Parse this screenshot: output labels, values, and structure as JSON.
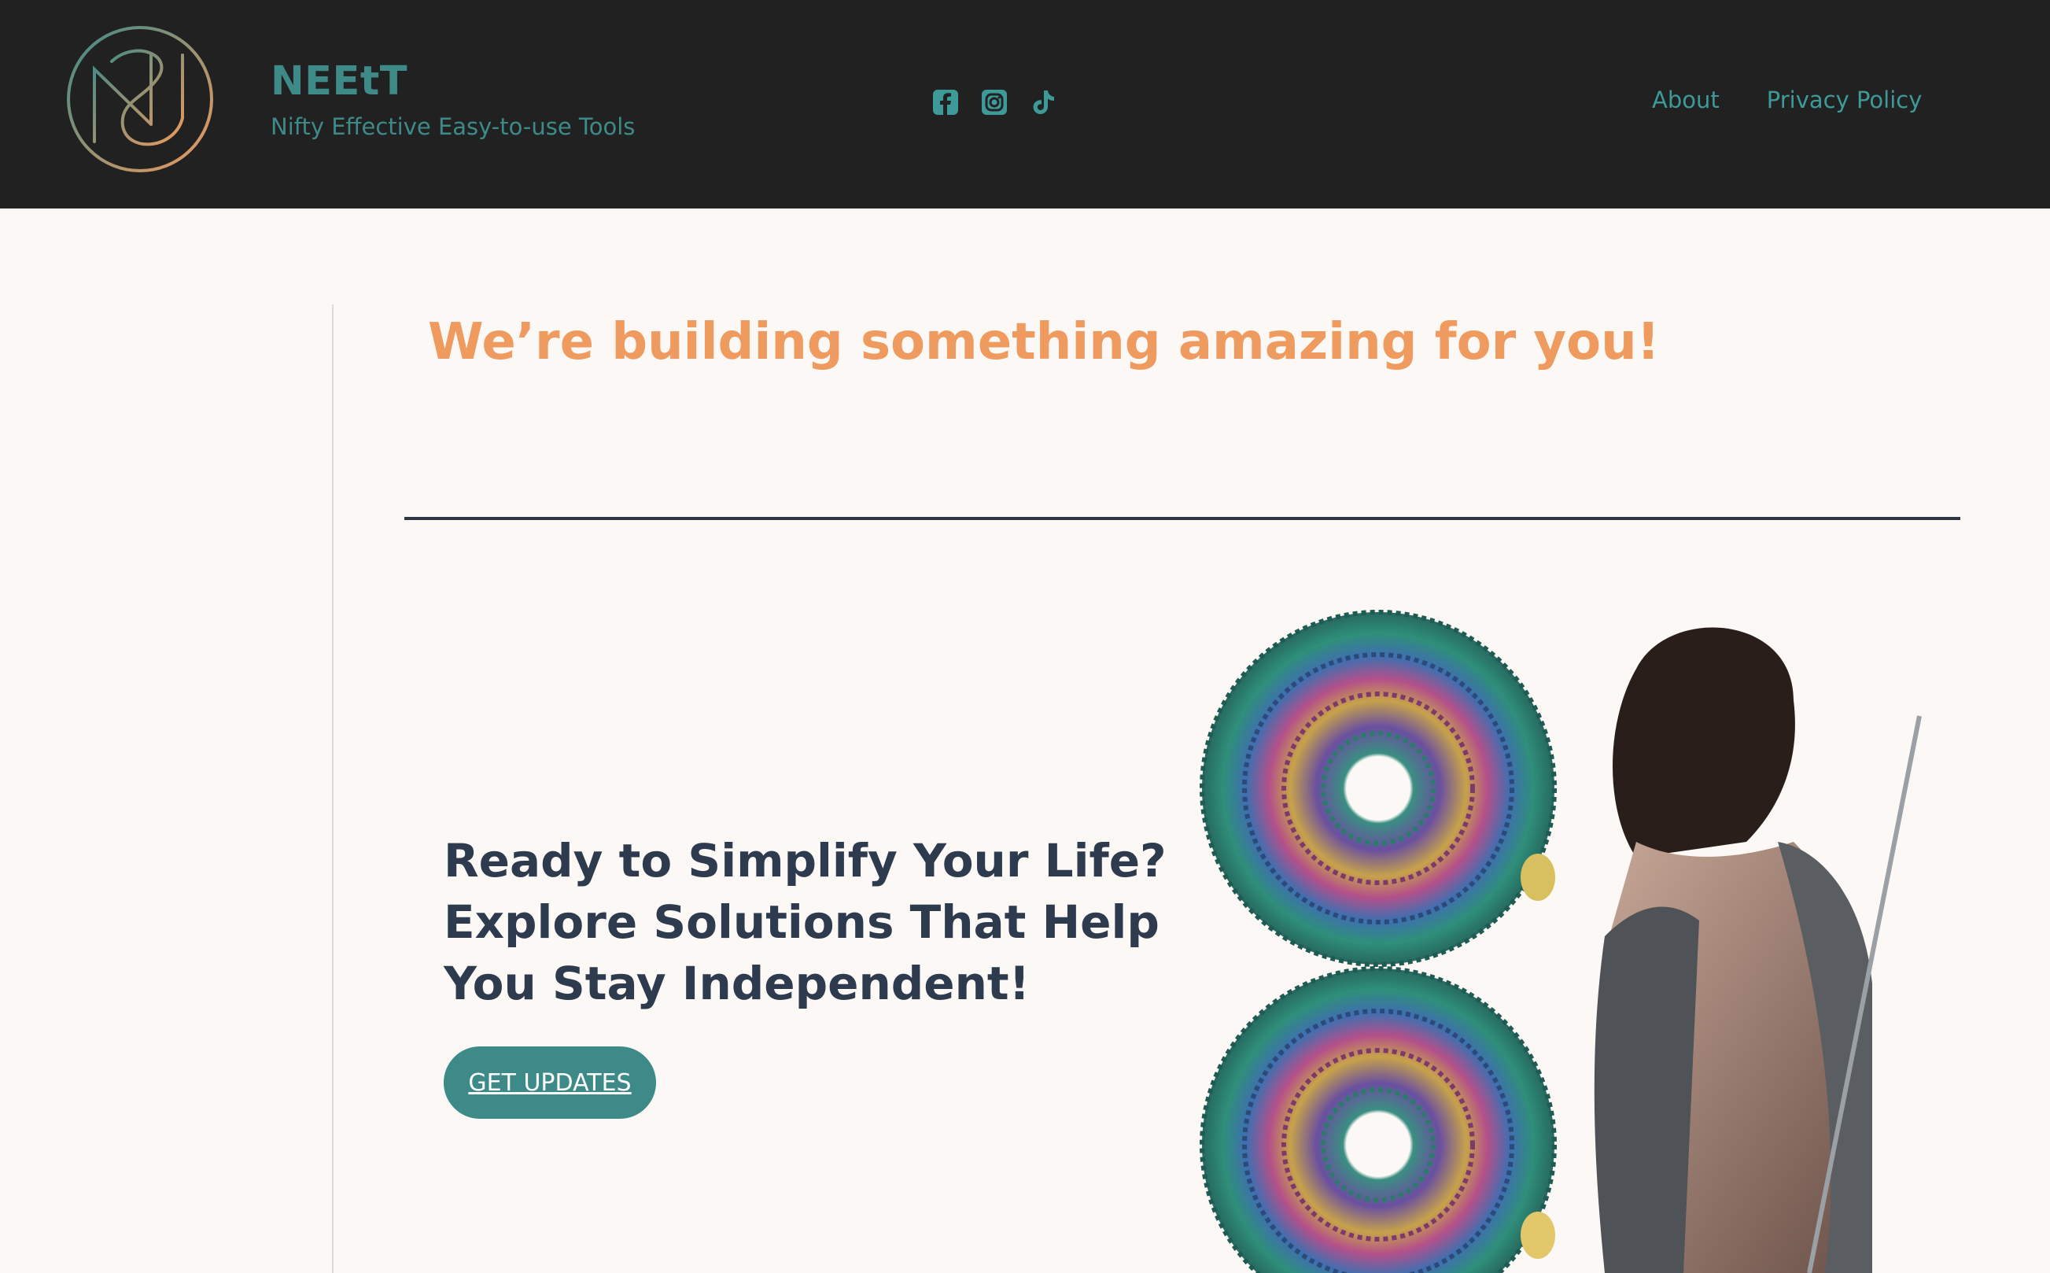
{
  "header": {
    "brand_name": "NEEtT",
    "tagline": "Nifty Effective Easy-to-use Tools",
    "logo_icon": "ns-monogram-logo",
    "socials": [
      {
        "name": "facebook-icon"
      },
      {
        "name": "instagram-icon"
      },
      {
        "name": "tiktok-icon"
      }
    ],
    "nav": [
      {
        "label": "About"
      },
      {
        "label": "Privacy Policy"
      }
    ]
  },
  "main": {
    "headline": "We’re building something amazing for you!",
    "cta_lines": [
      "Ready to Simplify Your Life?",
      "Explore Solutions That Help",
      "You Stay Independent!"
    ],
    "cta_button": "GET UPDATES",
    "hero_image": "rainbow-chain-necklaces-and-woman-back"
  },
  "colors": {
    "header_bg": "#212121",
    "teal": "#3d8a88",
    "orange": "#ef9a5e",
    "navy": "#2e3a4e",
    "page_bg": "#fcf8f5"
  }
}
